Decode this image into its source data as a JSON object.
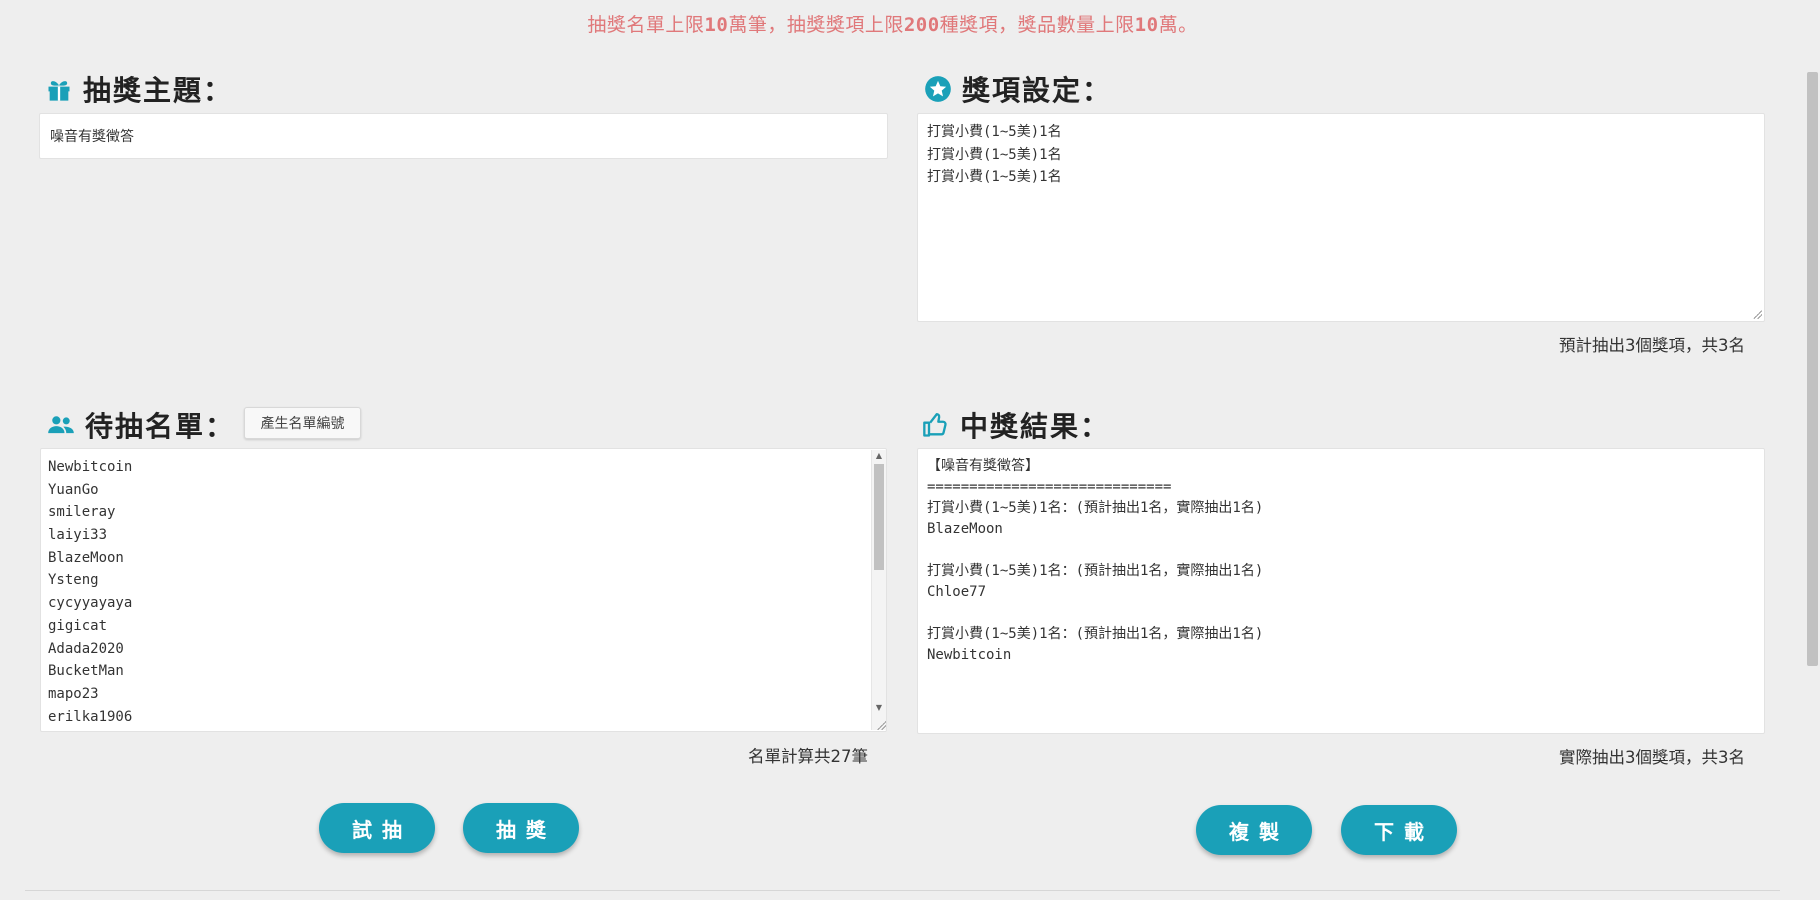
{
  "notice": {
    "p1": "抽獎名單上限",
    "n1": "10",
    "p2": "萬筆，抽獎獎項上限",
    "n2": "200",
    "p3": "種獎項，獎品數量上限",
    "n3": "10",
    "p4": "萬。"
  },
  "topic": {
    "title": "抽獎主題：",
    "icon": "gift-icon",
    "value": "噪音有獎徵答"
  },
  "prizes": {
    "title": "獎項設定：",
    "icon": "star-icon",
    "lines": [
      "打賞小費(1~5美)1名",
      "打賞小費(1~5美)1名",
      "打賞小費(1~5美)1名"
    ],
    "summary": "預計抽出3個獎項，共3名"
  },
  "candidates": {
    "title": "待抽名單：",
    "icon": "people-icon",
    "generate_button": "產生名單編號",
    "names": [
      "Newbitcoin",
      "YuanGo",
      "smileray",
      "laiyi33",
      "BlazeMoon",
      "Ysteng",
      "cycyyayaya",
      "gigicat",
      "Adada2020",
      "BucketMan",
      "mapo23",
      "erilka1906"
    ],
    "summary": "名單計算共27筆"
  },
  "results": {
    "title": "中獎結果：",
    "icon": "thumbs-up-icon",
    "lines": [
      "【噪音有獎徵答】",
      "=============================",
      "打賞小費(1~5美)1名：(預計抽出1名，實際抽出1名)",
      "BlazeMoon",
      "",
      "打賞小費(1~5美)1名：(預計抽出1名，實際抽出1名)",
      "Chloe77",
      "",
      "打賞小費(1~5美)1名：(預計抽出1名，實際抽出1名)",
      "Newbitcoin"
    ],
    "summary": "實際抽出3個獎項，共3名"
  },
  "buttons": {
    "trial": "試抽",
    "draw": "抽獎",
    "copy": "複製",
    "download": "下載"
  },
  "colors": {
    "accent": "#1aa0b8",
    "notice": "#e0787a",
    "background": "#eeeeee"
  }
}
